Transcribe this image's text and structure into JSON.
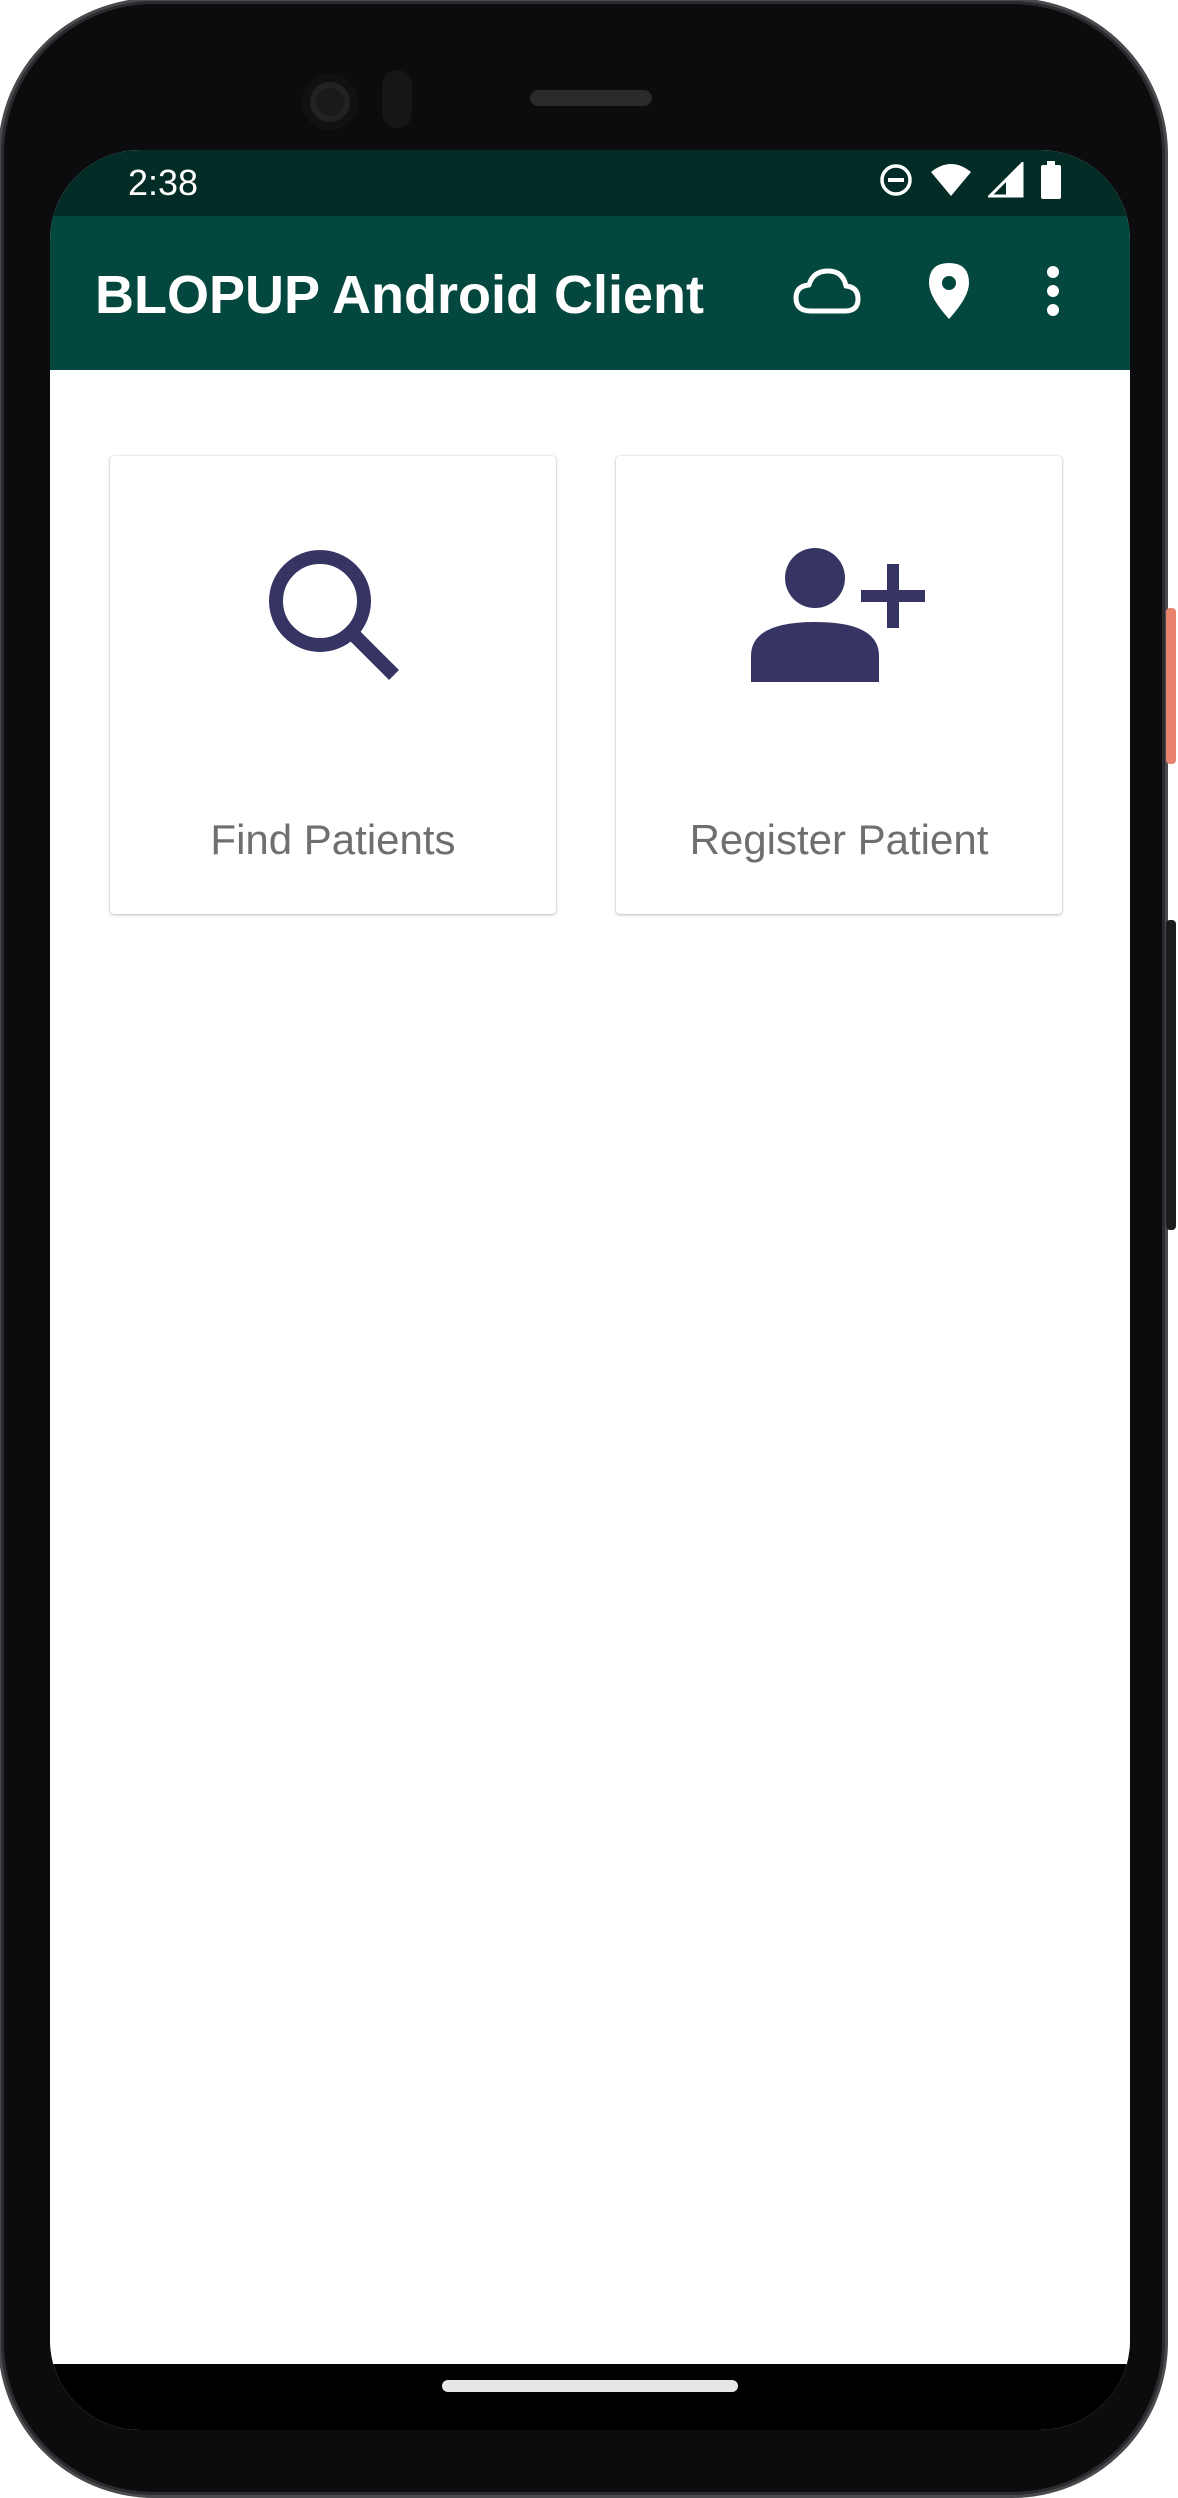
{
  "status_bar": {
    "time": "2:38",
    "icons": [
      "do-not-disturb-icon",
      "wifi-icon",
      "signal-icon",
      "battery-icon"
    ]
  },
  "app_bar": {
    "title": "BLOPUP Android Client",
    "actions": [
      "cloud-icon",
      "location-pin-icon",
      "more-vert-icon"
    ],
    "background": "#03473e"
  },
  "dashboard": {
    "tiles": [
      {
        "label": "Find Patients",
        "icon": "search-icon"
      },
      {
        "label": "Register Patient",
        "icon": "person-add-icon"
      }
    ],
    "icon_color": "#363463"
  }
}
